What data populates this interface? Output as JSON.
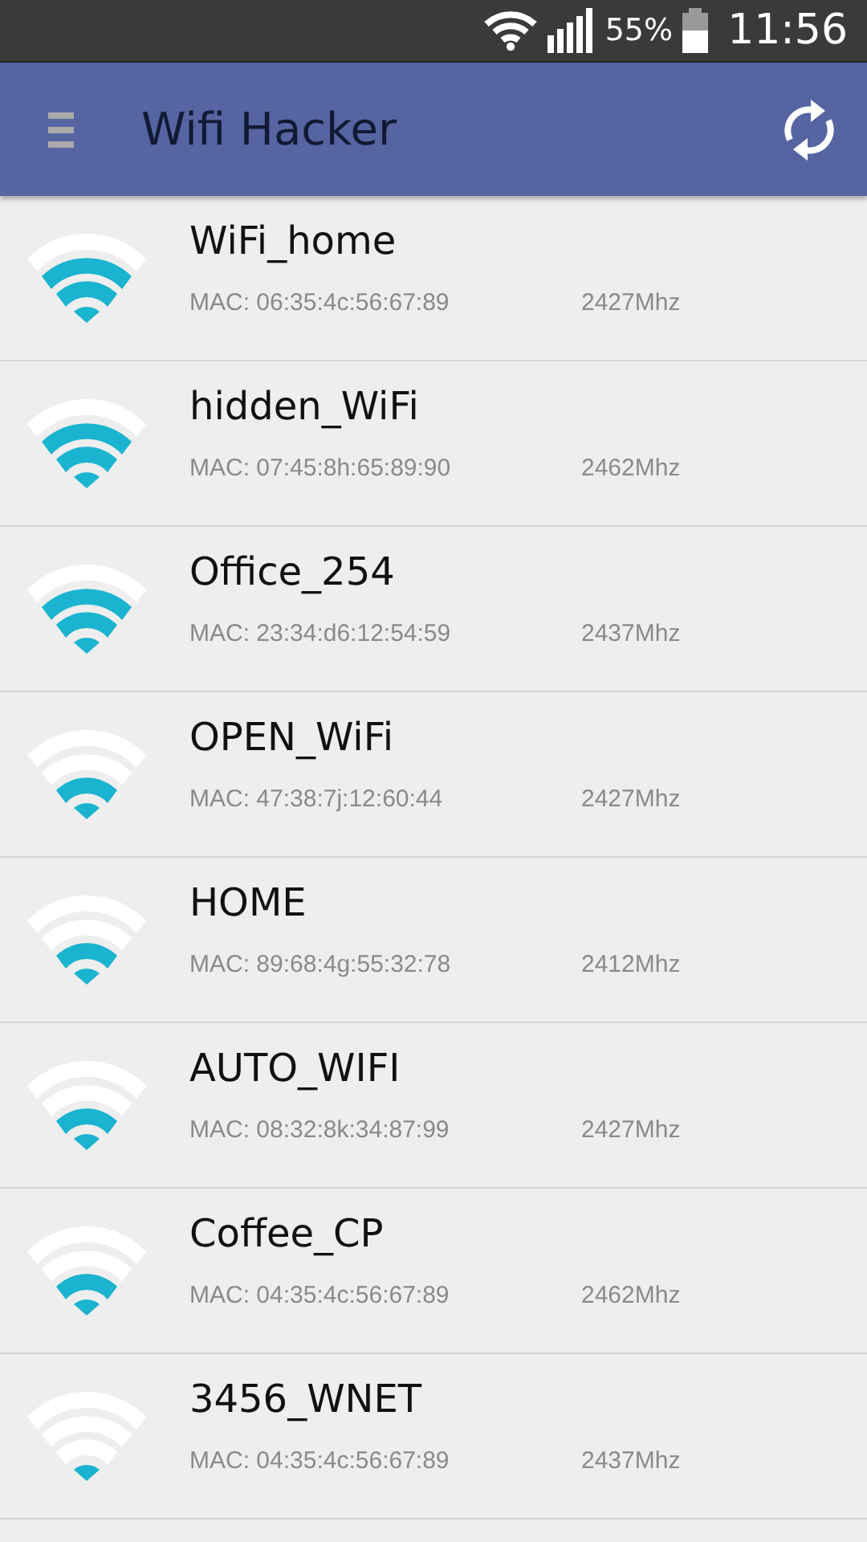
{
  "status_bar": {
    "battery": "55%",
    "time": "11:56"
  },
  "app_bar": {
    "title": "Wifi Hacker"
  },
  "networks": [
    {
      "name": "WiFi_home",
      "mac": "MAC: 06:35:4c:56:67:89",
      "frequency": "2427Mhz",
      "level": 0.75
    },
    {
      "name": "hidden_WiFi",
      "mac": "MAC: 07:45:8h:65:89:90",
      "frequency": "2462Mhz",
      "level": 0.75
    },
    {
      "name": "Office_254",
      "mac": "MAC: 23:34:d6:12:54:59",
      "frequency": "2437Mhz",
      "level": 0.75
    },
    {
      "name": "OPEN_WiFi",
      "mac": "MAC: 47:38:7j:12:60:44",
      "frequency": "2427Mhz",
      "level": 0.5
    },
    {
      "name": "HOME",
      "mac": "MAC: 89:68:4g:55:32:78",
      "frequency": "2412Mhz",
      "level": 0.5
    },
    {
      "name": "AUTO_WIFI",
      "mac": "MAC: 08:32:8k:34:87:99",
      "frequency": "2427Mhz",
      "level": 0.5
    },
    {
      "name": "Coffee_CP",
      "mac": "MAC: 04:35:4c:56:67:89",
      "frequency": "2462Mhz",
      "level": 0.5
    },
    {
      "name": "3456_WNET",
      "mac": "MAC: 04:35:4c:56:67:89",
      "frequency": "2437Mhz",
      "level": 0.25
    }
  ]
}
